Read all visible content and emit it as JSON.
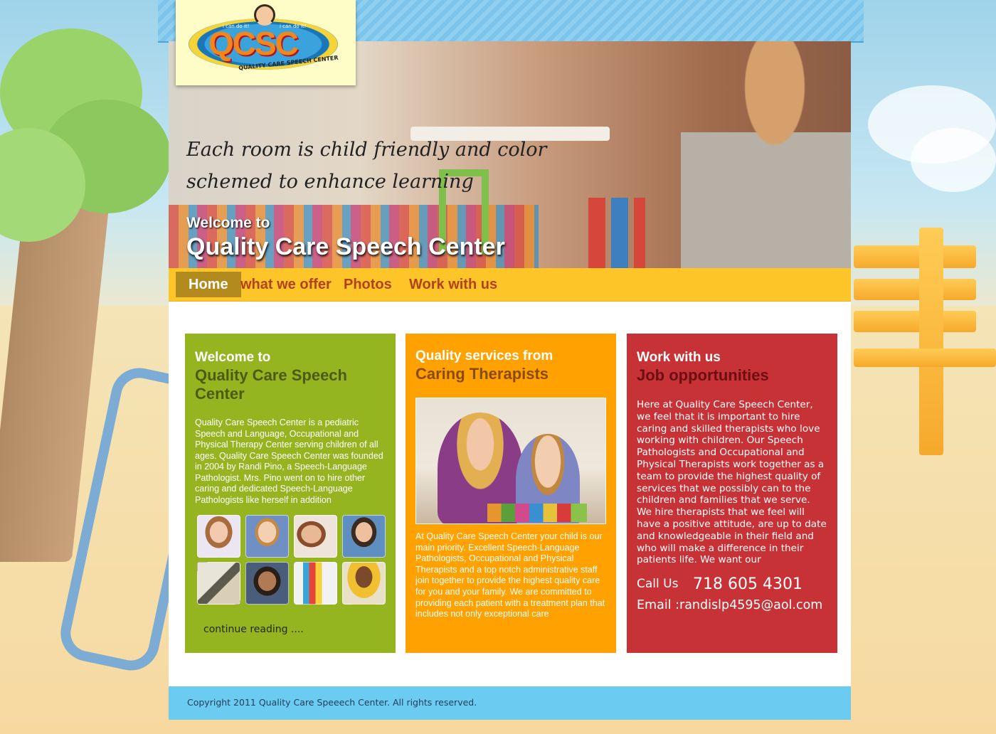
{
  "logo": {
    "acronym": "QCSC",
    "subtitle": "QUALITY CARE SPEECH CENTER",
    "badge_text_left": "i can do it!",
    "badge_text_right": "i can do it!"
  },
  "hero": {
    "tagline": "Each room is child friendly and color schemed to enhance learning",
    "welcome_small": "Welcome to",
    "welcome_big": "Quality Care Speech Center"
  },
  "nav": {
    "items": [
      {
        "label": "Home",
        "active": true
      },
      {
        "label": "what we offer",
        "active": false
      },
      {
        "label": "Photos",
        "active": false
      },
      {
        "label": "Work with us",
        "active": false
      }
    ]
  },
  "boxes": {
    "welcome": {
      "heading": "Welcome to",
      "subheading": "Quality Care Speech Center",
      "body": "Quality Care Speech Center is a pediatric Speech and Language, Occupational and Physical Therapy Center serving children of all ages. Quality Care Speech Center was founded in 2004 by Randi Pino, a Speech-Language Pathologist. Mrs. Pino went on to hire other caring and dedicated Speech-Language Pathologists like herself in addition",
      "continue_label": "continue reading ...."
    },
    "services": {
      "heading": "Quality services from",
      "subheading": "Caring Therapists",
      "body": "At Quality Care Speech Center your child is our main priority. Excellent Speech-Language Pathologists, Occupational and Physical Therapists and a top notch administrative staff join together to provide the highest quality care for you and your family. We are committed to providing each patient with a treatment plan that includes not only exceptional care"
    },
    "work": {
      "heading": "Work with us",
      "subheading": "Job opportunities",
      "body": "Here at Quality Care Speech Center, we feel that it is important to hire caring and skilled therapists who love working with children. Our Speech Pathologists and Occupational and Physical Therapists work together as a team to provide the highest quality of services that we possibly can to the children and families that we serve. We hire therapists that we feel will have a positive attitude, are up to date and knowledgeable in their field and who will make a difference in their patients life. We want our",
      "call_label": "Call Us",
      "phone": "718 605 4301",
      "email": "Email :randislp4595@aol.com"
    }
  },
  "footer": {
    "copyright": "Copyright 2011 Quality Care Speeech Center. All rights reserved."
  },
  "colors": {
    "green_box": "#94b520",
    "orange_box": "#ffa101",
    "red_box": "#c63235",
    "nav_bar": "#fdc527",
    "nav_active": "#b38a1d",
    "nav_text": "#b3411a",
    "footer": "#6ccbf0"
  }
}
